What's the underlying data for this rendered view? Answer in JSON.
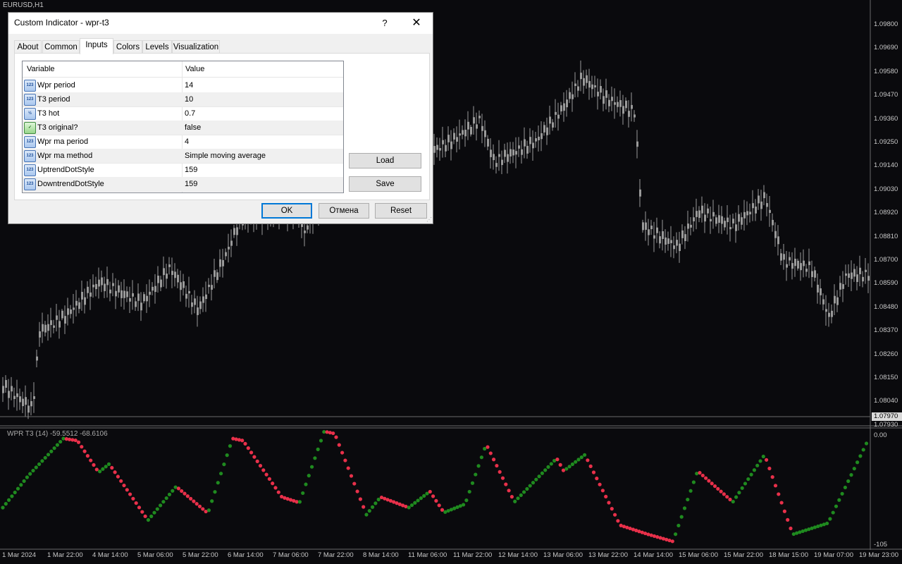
{
  "chart": {
    "symbol_label": "EURUSD,H1",
    "price_levels": [
      "1.09800",
      "1.09690",
      "1.09580",
      "1.09470",
      "1.09360",
      "1.09250",
      "1.09140",
      "1.09030",
      "1.08920",
      "1.08810",
      "1.08700",
      "1.08590",
      "1.08480",
      "1.08370",
      "1.08260",
      "1.08150",
      "1.08040",
      "1.07930"
    ],
    "current_price": "1.07970",
    "indicator_label": "WPR T3 (14) -59.5512 -68.6106",
    "indicator_max": "0.00",
    "indicator_min": "-105",
    "time_labels": [
      "1 Mar 2024",
      "1 Mar 22:00",
      "4 Mar 14:00",
      "5 Mar 06:00",
      "5 Mar 22:00",
      "6 Mar 14:00",
      "7 Mar 06:00",
      "7 Mar 22:00",
      "8 Mar 14:00",
      "11 Mar 06:00",
      "11 Mar 22:00",
      "12 Mar 14:00",
      "13 Mar 06:00",
      "13 Mar 22:00",
      "14 Mar 14:00",
      "15 Mar 06:00",
      "15 Mar 22:00",
      "18 Mar 15:00",
      "19 Mar 07:00",
      "19 Mar 23:00"
    ],
    "colors": {
      "background": "#0a0a0d",
      "candles": "#9a9a9a",
      "uptrend": "#1f8a1f",
      "downtrend": "#e8304a"
    }
  },
  "dialog": {
    "title": "Custom Indicator - wpr-t3",
    "help_label": "?",
    "close_label": "✕",
    "tabs": [
      "About",
      "Common",
      "Inputs",
      "Colors",
      "Levels",
      "Visualization"
    ],
    "active_tab": "Inputs",
    "grid": {
      "col_variable": "Variable",
      "col_value": "Value",
      "rows": [
        {
          "icon": "123",
          "name": "Wpr period",
          "value": "14"
        },
        {
          "icon": "123",
          "name": "T3 period",
          "value": "10"
        },
        {
          "icon": "½",
          "name": "T3 hot",
          "value": "0.7"
        },
        {
          "icon": "bool",
          "name": "T3 original?",
          "value": "false"
        },
        {
          "icon": "123",
          "name": "Wpr ma period",
          "value": "4"
        },
        {
          "icon": "123",
          "name": "Wpr ma method",
          "value": "Simple moving average"
        },
        {
          "icon": "123",
          "name": "UptrendDotStyle",
          "value": "159"
        },
        {
          "icon": "123",
          "name": "DowntrendDotStyle",
          "value": "159"
        }
      ]
    },
    "buttons": {
      "load": "Load",
      "save": "Save",
      "ok": "OK",
      "cancel": "Отмена",
      "reset": "Reset"
    }
  }
}
